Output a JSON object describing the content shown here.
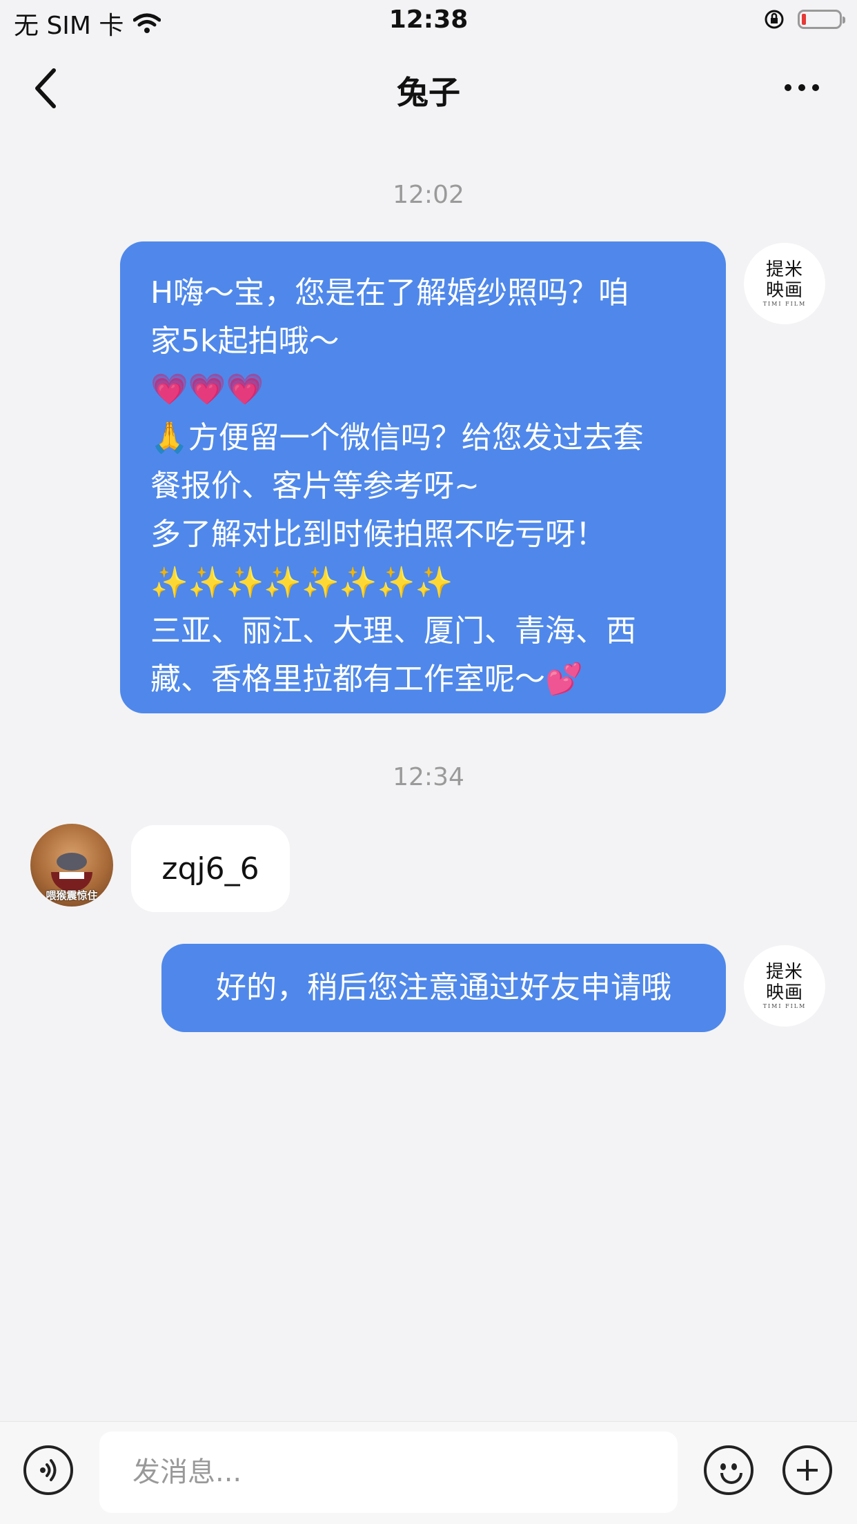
{
  "status_bar": {
    "carrier": "无 SIM 卡",
    "time": "12:38"
  },
  "nav": {
    "title": "兔子"
  },
  "timestamps": [
    "12:02",
    "12:34"
  ],
  "brand_avatar": {
    "line1": "提米",
    "line2": "映画",
    "tiny": "TIMI FILM"
  },
  "messages": {
    "first": [
      "H嗨～宝，您是在了解婚纱照吗？咱",
      "家5k起拍哦～",
      "💗💗💗",
      "🙏方便留一个微信吗？给您发过去套",
      "餐报价、客片等参考呀~",
      "多了解对比到时候拍照不吃亏呀！",
      "✨✨✨✨✨✨✨✨",
      "三亚、丽江、大理、厦门、青海、西",
      "藏、香格里拉都有工作室呢～💕"
    ],
    "user_reply": "zqj6_6",
    "final": "好的，稍后您注意通过好友申请哦"
  },
  "user_avatar": {
    "caption": "喂猴震惊住"
  },
  "composer": {
    "placeholder": "发消息..."
  }
}
